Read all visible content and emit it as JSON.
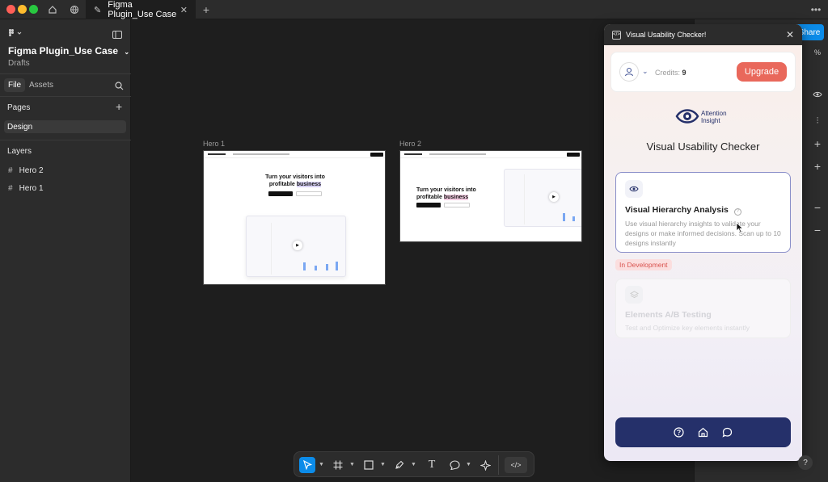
{
  "tab": {
    "title": "Figma Plugin_Use Case",
    "close": "✕",
    "add": "+"
  },
  "file": {
    "name": "Figma Plugin_Use Case",
    "location": "Drafts"
  },
  "left_tabs": {
    "file": "File",
    "assets": "Assets"
  },
  "pages": {
    "heading": "Pages",
    "add": "+",
    "items": [
      "Design"
    ]
  },
  "layers": {
    "heading": "Layers",
    "items": [
      "Hero 2",
      "Hero 1"
    ]
  },
  "frames": [
    {
      "label": "Hero 1",
      "headline_a": "Turn your visitors into",
      "headline_b": "profitable",
      "headline_c": "business"
    },
    {
      "label": "Hero 2",
      "headline_a": "Turn your visitors into",
      "headline_b": "profitable",
      "headline_c": "business"
    }
  ],
  "right": {
    "share": "Share",
    "zoom": "%"
  },
  "plugin": {
    "title": "Visual Usability Checker!",
    "close": "✕",
    "credits_label": "Credits:",
    "credits_value": "9",
    "upgrade": "Upgrade",
    "logo_line1": "Attention",
    "logo_line2": "Insight",
    "heading": "Visual Usability Checker",
    "card1": {
      "title": "Visual Hierarchy Analysis",
      "desc": "Use visual hierarchy insights to validate your designs or make informed decisions. Scan up to 10 designs instantly"
    },
    "badge": "In Development",
    "card2": {
      "title": "Elements A/B Testing",
      "desc": "Test and Optimize key elements instantly"
    }
  },
  "help": "?",
  "colors": {
    "accent": "#0c8ce9",
    "upgrade": "#e9685b",
    "nav": "#25306a",
    "badge_text": "#d9534f"
  }
}
